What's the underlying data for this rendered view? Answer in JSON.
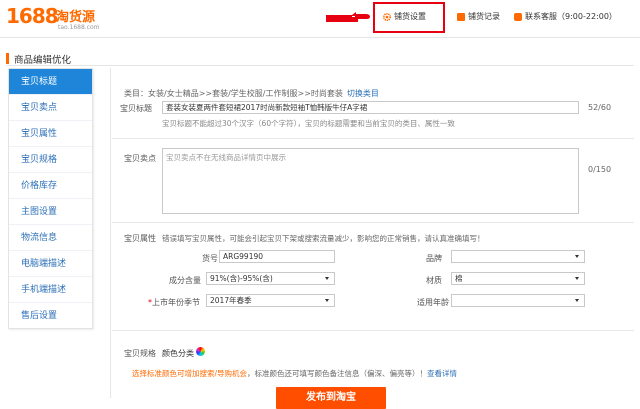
{
  "header": {
    "logo_number": "1688",
    "logo_name": "淘货源",
    "logo_sub": "tao.1688.com",
    "settings_label": "铺货设置",
    "records_label": "铺货记录",
    "service_label": "联系客服（9:00-22:00）"
  },
  "page_title": "商品编辑优化",
  "sidebar": {
    "items": [
      {
        "label": "宝贝标题"
      },
      {
        "label": "宝贝卖点"
      },
      {
        "label": "宝贝属性"
      },
      {
        "label": "宝贝规格"
      },
      {
        "label": "价格库存"
      },
      {
        "label": "主图设置"
      },
      {
        "label": "物流信息"
      },
      {
        "label": "电脑端描述"
      },
      {
        "label": "手机端描述"
      },
      {
        "label": "售后设置"
      }
    ]
  },
  "category": {
    "text": "类目：女装/女士精品>>套装/学生校服/工作制服>>时尚套装",
    "switch_label": "切换类目"
  },
  "title_field": {
    "label": "宝贝标题",
    "value": "套装女装夏两件套短裙2017时尚新款短袖T恤韩版牛仔A字裙",
    "counter": "52/60",
    "hint": "宝贝标题不能超过30个汉字（60个字符），宝贝的标题需要和当前宝贝的类目、属性一致"
  },
  "selling_point": {
    "label": "宝贝卖点",
    "placeholder": "宝贝卖点不在无线商品详情页中展示",
    "counter": "0/150"
  },
  "attributes": {
    "label": "宝贝属性",
    "warning": "错误填写宝贝属性，可能会引起宝贝下架或搜索流量减少，影响您的正常销售，请认真准确填写！",
    "item_no_label": "货号",
    "item_no_value": "ARG99190",
    "brand_label": "品牌",
    "brand_value": "",
    "content_label": "成分含量",
    "content_value": "91%(含)-95%(含)",
    "material_label": "材质",
    "material_value": "棉",
    "season_required": "*",
    "season_label": "上市年份季节",
    "season_value": "2017年春季",
    "age_label": "适用年龄",
    "age_value": ""
  },
  "spec": {
    "label": "宝贝规格",
    "color_label": "颜色分类"
  },
  "note": {
    "orange_text": "选择标准颜色可增加搜索/导购机会",
    "rest_text": "，标准颜色还可填写颜色备注信息（偏深、偏亮等）！",
    "link_text": "查看详情"
  },
  "publish_label": "发布到淘宝",
  "colors": {
    "brand": "#ff6a00",
    "nav_active": "#1e85d8",
    "link": "#2c6fb7",
    "publish": "#ff4e00",
    "highlight_box": "#e60012"
  }
}
